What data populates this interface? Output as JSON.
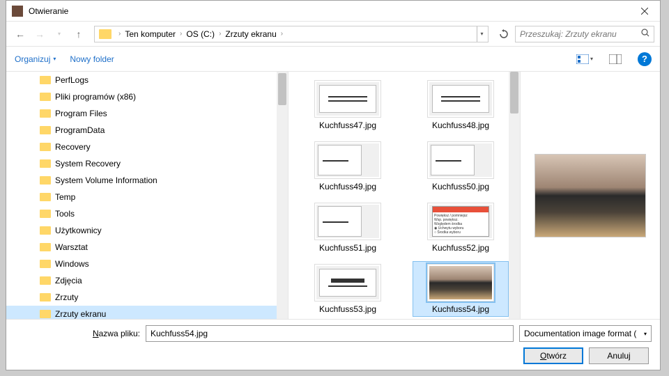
{
  "title": "Otwieranie",
  "breadcrumb": {
    "root": "Ten komputer",
    "drive": "OS (C:)",
    "folder": "Zrzuty ekranu"
  },
  "search": {
    "placeholder": "Przeszukaj: Zrzuty ekranu"
  },
  "toolbar": {
    "organize": "Organizuj",
    "newfolder": "Nowy folder"
  },
  "tree": [
    "PerfLogs",
    "Pliki programów (x86)",
    "Program Files",
    "ProgramData",
    "Recovery",
    "System Recovery",
    "System Volume Information",
    "Temp",
    "Tools",
    "Użytkownicy",
    "Warsztat",
    "Windows",
    "Zdjęcia",
    "Zrzuty",
    "Zrzuty ekranu"
  ],
  "tree_selected_index": 14,
  "files": {
    "names": [
      "Kuchfuss47.jpg",
      "Kuchfuss48.jpg",
      "Kuchfuss49.jpg",
      "Kuchfuss50.jpg",
      "Kuchfuss51.jpg",
      "Kuchfuss52.jpg",
      "Kuchfuss53.jpg",
      "Kuchfuss54.jpg"
    ],
    "selected_index": 7
  },
  "footer": {
    "filename_label": "Nazwa pliku:",
    "filename_value": "Kuchfuss54.jpg",
    "format": "Documentation image format (",
    "open": "Otwórz",
    "cancel": "Anuluj"
  }
}
